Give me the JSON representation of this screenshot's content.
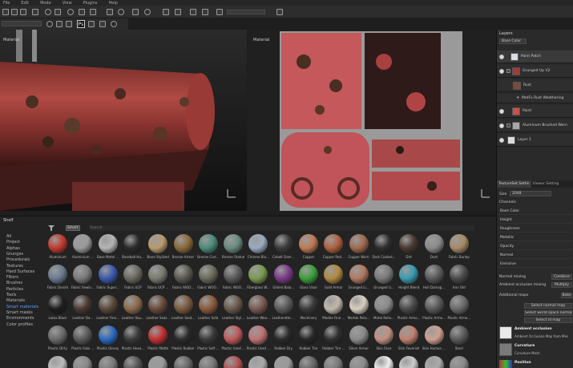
{
  "menu": [
    "File",
    "Edit",
    "Mode",
    "View",
    "Plugins",
    "Help"
  ],
  "viewport3d": {
    "label": "Material"
  },
  "viewport2d": {
    "label": "Material"
  },
  "layers": {
    "title": "Layers",
    "channel": "Base Color",
    "items": [
      {
        "name": "Paint Patch",
        "color": "#d8dde3"
      },
      {
        "name": "Grunged Up V2",
        "color": "#a33a3a"
      },
      {
        "name": "Rust",
        "color": "#7a4a3a"
      },
      {
        "name": "MatFx Rust Weathering",
        "color": "#a03030"
      },
      {
        "name": "Paint",
        "color": "#c85050"
      },
      {
        "name": "Aluminum Brushed Worn",
        "color": "#a8a8a8"
      },
      {
        "name": "Layer 1",
        "color": "#dcdcdc"
      }
    ]
  },
  "textureset": {
    "tab1": "TextureSet Settin",
    "tab2": "Viewer Setting",
    "size_label": "Size",
    "size_value": "2048",
    "channels_label": "Channels",
    "channels": [
      "Base Color",
      "Height",
      "Roughness",
      "Metallic",
      "Opacity",
      "Normal",
      "Emissive"
    ],
    "normal_mixing_label": "Normal mixing",
    "normal_mixing_value": "Combine",
    "ao_mixing_label": "Ambient occlusion mixing",
    "ao_mixing_value": "Multiply",
    "additional_maps_label": "Additional maps",
    "bake_button": "Bake",
    "select_normal_map": "Select normal map",
    "select_world_space": "Select world space normal m",
    "select_id_map": "Select id map",
    "maps": [
      {
        "title": "Ambient occlusion",
        "sub": "Ambient Occlusion Map from Mes"
      },
      {
        "title": "Curvature",
        "sub": "Curvature Mesh"
      },
      {
        "title": "Position",
        "sub": ""
      }
    ]
  },
  "shelf": {
    "title": "Shelf",
    "filter_tag": "Smart",
    "search_placeholder": "Search",
    "categories": [
      "All",
      "Project",
      "Alphas",
      "Grunges",
      "Procedurals",
      "Textures",
      "Hard Surfaces",
      "Filters",
      "Brushes",
      "Particles",
      "Tools",
      "Materials",
      "Smart materials",
      "Smart masks",
      "Environments",
      "Color profiles"
    ],
    "active_category": "Smart materials",
    "rows": [
      [
        {
          "n": "Aluminium",
          "c": "#c23a2e"
        },
        {
          "n": "Aluminium ...",
          "c": "#9a9a9a"
        },
        {
          "n": "Base Metal ...",
          "c": "#b4b4b4"
        },
        {
          "n": "Baseball Ha...",
          "c": "#2a2a2a"
        },
        {
          "n": "Bone Stylized",
          "c": "#b89a6e"
        },
        {
          "n": "Bronze Armor",
          "c": "#8a6a3a"
        },
        {
          "n": "Bronze Corr...",
          "c": "#4a8a7a"
        },
        {
          "n": "Bronze Statue",
          "c": "#6a8a80"
        },
        {
          "n": "Chrome Blu...",
          "c": "#9aaac0"
        },
        {
          "n": "Cobalt Dam...",
          "c": "#3a3a3a"
        },
        {
          "n": "Copper",
          "c": "#c07a55"
        },
        {
          "n": "Copper Red...",
          "c": "#b06040"
        },
        {
          "n": "Copper Worn",
          "c": "#a06a50"
        },
        {
          "n": "Dark Coated...",
          "c": "#2e2e2e"
        },
        {
          "n": "Dirt",
          "c": "#4a3a30"
        },
        {
          "n": "Dust",
          "c": "#8a8a8a"
        },
        {
          "n": "Fabric Burlap",
          "c": "#a88a66"
        }
      ],
      [
        {
          "n": "Fabric Denim",
          "c": "#6a7a90"
        },
        {
          "n": "Fabric Sewin...",
          "c": "#7a7a7a"
        },
        {
          "n": "Fabric Super...",
          "c": "#3a5ab0"
        },
        {
          "n": "Fabric UCP",
          "c": "#6a6a60"
        },
        {
          "n": "Fabric UCP ...",
          "c": "#7a7a70"
        },
        {
          "n": "Fabric WOO...",
          "c": "#5a5a50"
        },
        {
          "n": "Fabric WOO...",
          "c": "#6a6a5a"
        },
        {
          "n": "Fabric WOO...",
          "c": "#5a5a5a"
        },
        {
          "n": "Fiberglass W...",
          "c": "#7a9a50"
        },
        {
          "n": "Gilded Bala...",
          "c": "#7a3a8a"
        },
        {
          "n": "Glass Visor",
          "c": "#3aa03a"
        },
        {
          "n": "Gold Armor",
          "c": "#b08a40"
        },
        {
          "n": "Grunged Li...",
          "c": "#b07a60"
        },
        {
          "n": "Grunged U...",
          "c": "#7a7a7a"
        },
        {
          "n": "Height Blend",
          "c": "#3a9ab0"
        },
        {
          "n": "Hull Damag...",
          "c": "#5a5a5a"
        },
        {
          "n": "Iron Old",
          "c": "#4a4a4a"
        }
      ],
      [
        {
          "n": "Latex Black",
          "c": "#1e1e1e"
        },
        {
          "n": "Leather Da...",
          "c": "#4a3a30"
        },
        {
          "n": "Leather Fine...",
          "c": "#5a4a3a"
        },
        {
          "n": "Leather Rou...",
          "c": "#8a6a4a"
        },
        {
          "n": "Leather Seat...",
          "c": "#6a4a3a"
        },
        {
          "n": "Leather Seat...",
          "c": "#7a5a40"
        },
        {
          "n": "Leather Sofa",
          "c": "#8a5a3a"
        },
        {
          "n": "Leather Styl...",
          "c": "#6a5a4a"
        },
        {
          "n": "Leather Wea...",
          "c": "#7a5a50"
        },
        {
          "n": "Leatherette ...",
          "c": "#5a5a5a"
        },
        {
          "n": "Machinery",
          "c": "#3a3a3a"
        },
        {
          "n": "Marble Fine ...",
          "c": "#c0b8aa"
        },
        {
          "n": "Marble Polis...",
          "c": "#d8d0c0"
        },
        {
          "n": "Metal Rollo...",
          "c": "#8a8a8a"
        },
        {
          "n": "Plastic Armo...",
          "c": "#4a4a4a"
        },
        {
          "n": "Plastic Armo...",
          "c": "#5a5a5a"
        },
        {
          "n": "Plastic Armo...",
          "c": "#6a6a6a"
        }
      ],
      [
        {
          "n": "Plastic Dirty",
          "c": "#6a6a6a"
        },
        {
          "n": "Plastic Fake ...",
          "c": "#5a5a5a"
        },
        {
          "n": "Plastic Glossy",
          "c": "#2a6ac0"
        },
        {
          "n": "Plastic Hexa...",
          "c": "#3a3a3a"
        },
        {
          "n": "Plastic Matte",
          "c": "#c03030"
        },
        {
          "n": "Plastic Rubber",
          "c": "#2a2a2a"
        },
        {
          "n": "Plastic Soft ...",
          "c": "#3a3a3a"
        },
        {
          "n": "Plastic Used ...",
          "c": "#c05a5a"
        },
        {
          "n": "Plastic Used ...",
          "c": "#c07070"
        },
        {
          "n": "Rubber Dry",
          "c": "#2a2a2a"
        },
        {
          "n": "Rubber Tire",
          "c": "#262626"
        },
        {
          "n": "Rubber Tire ...",
          "c": "#303030"
        },
        {
          "n": "Silver Armor",
          "c": "#8a8a8a"
        },
        {
          "n": "Skin Face",
          "c": "#c09080"
        },
        {
          "n": "Skin Feverish",
          "c": "#c08070"
        },
        {
          "n": "Skin Human ...",
          "c": "#d0a090"
        },
        {
          "n": "Steel",
          "c": "#5a5a5a"
        }
      ],
      [
        {
          "n": "",
          "c": "#bbbbbb"
        },
        {
          "n": "",
          "c": "#888888"
        },
        {
          "n": "",
          "c": "#7a7a7a"
        },
        {
          "n": "",
          "c": "#555555"
        },
        {
          "n": "",
          "c": "#999999"
        },
        {
          "n": "",
          "c": "#666666"
        },
        {
          "n": "",
          "c": "#777777"
        },
        {
          "n": "",
          "c": "#b05050"
        },
        {
          "n": "",
          "c": "#aaaaaa"
        },
        {
          "n": "",
          "c": "#999999"
        },
        {
          "n": "",
          "c": "#666666"
        },
        {
          "n": "",
          "c": "#7a7a7a"
        },
        {
          "n": "",
          "c": "#8a8a8a"
        },
        {
          "n": "",
          "c": "#eeeeee"
        },
        {
          "n": "",
          "c": "#cccccc"
        },
        {
          "n": "",
          "c": "#aaaaaa"
        },
        {
          "n": "",
          "c": "#888888"
        }
      ]
    ]
  }
}
